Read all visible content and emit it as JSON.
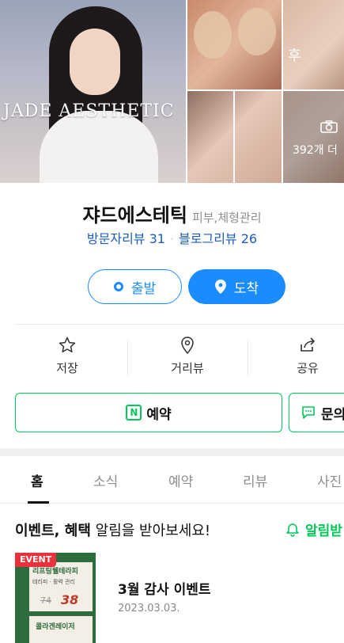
{
  "photos": {
    "brand_overlay": "JADE AESTHETIC",
    "before_after_label": "후",
    "photo_count": "392개 더"
  },
  "place": {
    "name": "쟈드에스테틱",
    "category": "피부,체형관리",
    "visitor_reviews": "방문자리뷰 31",
    "blog_reviews": "블로그리뷰 26"
  },
  "route": {
    "start_label": "출발",
    "arrive_label": "도착"
  },
  "actions": [
    {
      "label": "저장",
      "icon": "star-icon"
    },
    {
      "label": "거리뷰",
      "icon": "location-pin-icon"
    },
    {
      "label": "공유",
      "icon": "share-icon"
    }
  ],
  "booking": {
    "reserve_label": "예약",
    "reserve_badge": "N",
    "ask_label": "문의"
  },
  "tabs": [
    {
      "label": "홈",
      "active": true
    },
    {
      "label": "소식",
      "active": false
    },
    {
      "label": "예약",
      "active": false
    },
    {
      "label": "리뷰",
      "active": false
    },
    {
      "label": "사진",
      "active": false
    }
  ],
  "events_section": {
    "heading_bold": "이벤트, 혜택",
    "heading_rest": " 알림을 받아보세요!",
    "alarm_label": "알림받"
  },
  "event_card": {
    "badge": "EVENT",
    "title": "3월 감사 이벤트",
    "date": "2023.03.03.",
    "thumb_text1": "리프팅웰테라피",
    "thumb_text2": "테라피 · 활력 관리",
    "thumb_old_price": "74",
    "thumb_price": "38",
    "thumb_text3": "콜라겐레이저"
  },
  "colors": {
    "naver_green": "#03c75a",
    "route_blue": "#1a8cff",
    "review_blue": "#1b5dbf",
    "event_red": "#e8313b"
  }
}
